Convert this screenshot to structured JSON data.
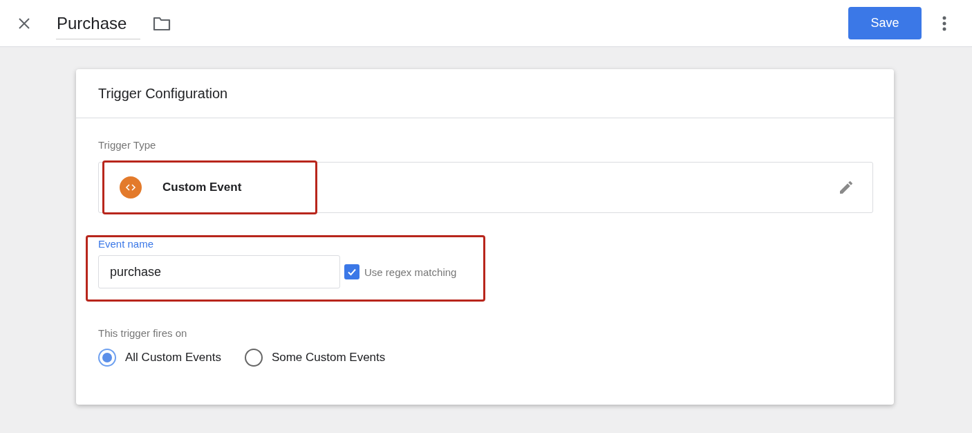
{
  "header": {
    "title": "Purchase",
    "save_label": "Save"
  },
  "card": {
    "title": "Trigger Configuration",
    "trigger_type": {
      "label": "Trigger Type",
      "value": "Custom Event"
    },
    "event_name": {
      "label": "Event name",
      "value": "purchase",
      "regex": {
        "label": "Use regex matching",
        "checked": true
      }
    },
    "fires_on": {
      "label": "This trigger fires on",
      "options": [
        {
          "label": "All Custom Events",
          "selected": true
        },
        {
          "label": "Some Custom Events",
          "selected": false
        }
      ]
    }
  }
}
